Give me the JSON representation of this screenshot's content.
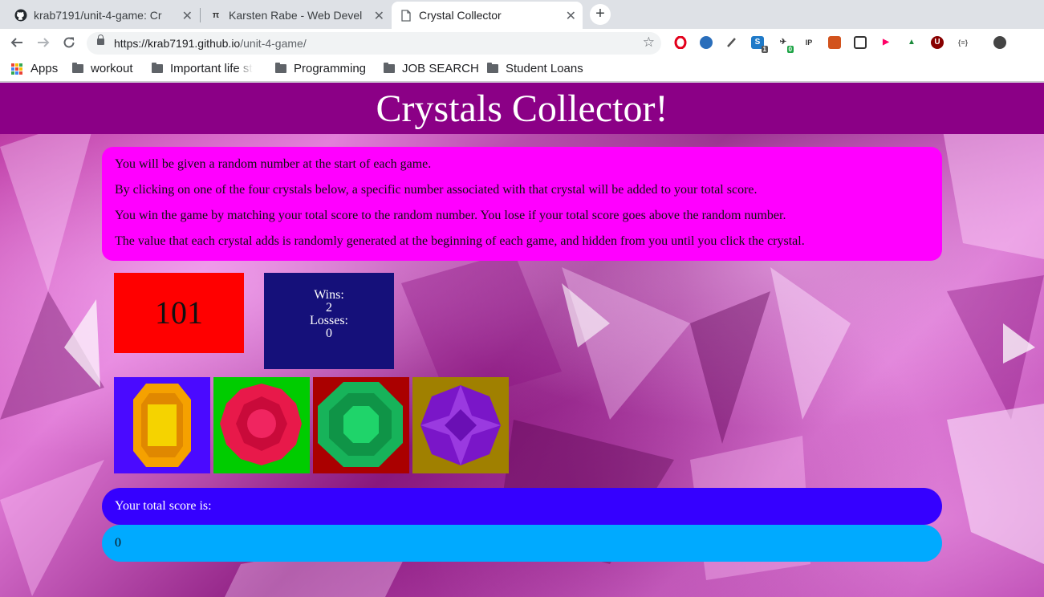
{
  "browser": {
    "tabs": [
      {
        "title": "krab7191/unit-4-game: Cr",
        "icon": "github-icon",
        "active": false
      },
      {
        "title": "Karsten Rabe - Web Devel",
        "icon": "pi-icon",
        "active": false
      },
      {
        "title": "Crystal Collector",
        "icon": "page-icon",
        "active": true
      }
    ],
    "close_glyph": "✕",
    "new_tab_glyph": "+",
    "url_host": "https://krab7191.github.io",
    "url_path": "/unit-4-game/",
    "extension_badges": {
      "ext_3": "1",
      "ext_4": "0"
    },
    "bookmarks": [
      {
        "label": "Apps",
        "icon": "apps-grid-icon"
      },
      {
        "label": "workout",
        "icon": "folder-icon"
      },
      {
        "label": "Important life st",
        "icon": "folder-icon"
      },
      {
        "label": "Programming",
        "icon": "folder-icon"
      },
      {
        "label": "JOB SEARCH",
        "icon": "folder-icon"
      },
      {
        "label": "Student Loans",
        "icon": "folder-icon"
      }
    ]
  },
  "game": {
    "title": "Crystals Collector!",
    "instructions": [
      "You will be given a random number at the start of each game.",
      "By clicking on one of the four crystals below, a specific number associated with that crystal will be added to your total score.",
      "You win the game by matching your total score to the random number. You lose if your total score goes above the random number.",
      "The value that each crystal adds is randomly generated at the beginning of each game, and hidden from you until you click the crystal."
    ],
    "target_number": "101",
    "wins_label": "Wins:",
    "wins": "2",
    "losses_label": "Losses:",
    "losses": "0",
    "crystals": [
      {
        "name": "orange-gem",
        "bg": "#4a0aff",
        "color": "#f5a100"
      },
      {
        "name": "red-gem",
        "bg": "#00cc00",
        "color": "#e8194a"
      },
      {
        "name": "green-gem",
        "bg": "#aa0000",
        "color": "#17b35a"
      },
      {
        "name": "purple-gem",
        "bg": "#a08000",
        "color": "#7a16c8"
      }
    ],
    "score_label": "Your total score is:",
    "score_value": "0"
  },
  "colors": {
    "header_bg": "#8b0086",
    "instructions_bg": "#ff00ff",
    "target_bg": "#ff0000",
    "record_bg": "#15107a",
    "score_label_bg": "#3500ff",
    "score_value_bg": "#00aaff"
  }
}
